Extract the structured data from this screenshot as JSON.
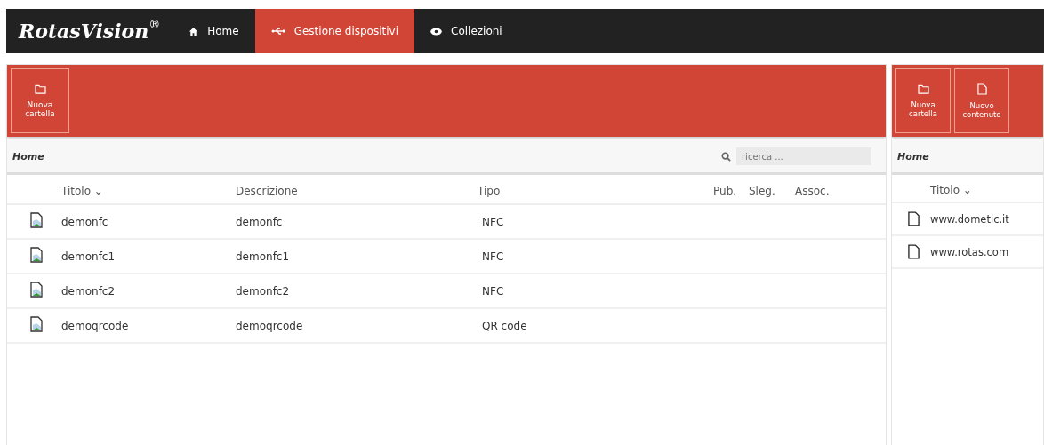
{
  "brand": {
    "name": "RotasVision",
    "mark": "®"
  },
  "nav": [
    {
      "label": "Home",
      "kind": "home",
      "selected": false
    },
    {
      "label": "Gestione dispositivi",
      "kind": "usb",
      "selected": true
    },
    {
      "label": "Collezioni",
      "kind": "eye",
      "selected": false
    }
  ],
  "left_panel": {
    "toolbar": [
      {
        "label": "Nuova cartella",
        "kind": "folder"
      }
    ],
    "breadcrumb": "Home",
    "search": {
      "placeholder": "ricerca ..."
    },
    "columns": [
      "Titolo ⌄",
      "Descrizione",
      "Tipo",
      "Pub.",
      "Sleg.",
      "Assoc."
    ],
    "rows": [
      {
        "title": "demonfc",
        "description": "demonfc",
        "type": "NFC"
      },
      {
        "title": "demonfc1",
        "description": "demonfc1",
        "type": "NFC"
      },
      {
        "title": "demonfc2",
        "description": "demonfc2",
        "type": "NFC"
      },
      {
        "title": "demoqrcode",
        "description": "demoqrcode",
        "type": "QR code"
      }
    ]
  },
  "right_panel": {
    "toolbar": [
      {
        "label": "Nuova cartella",
        "kind": "folder"
      },
      {
        "label": "Nuovo contenuto",
        "kind": "file"
      }
    ],
    "breadcrumb": "Home",
    "columns": [
      "Titolo ⌄"
    ],
    "rows": [
      {
        "title": "www.dometic.it"
      },
      {
        "title": "www.rotas.com"
      }
    ]
  }
}
